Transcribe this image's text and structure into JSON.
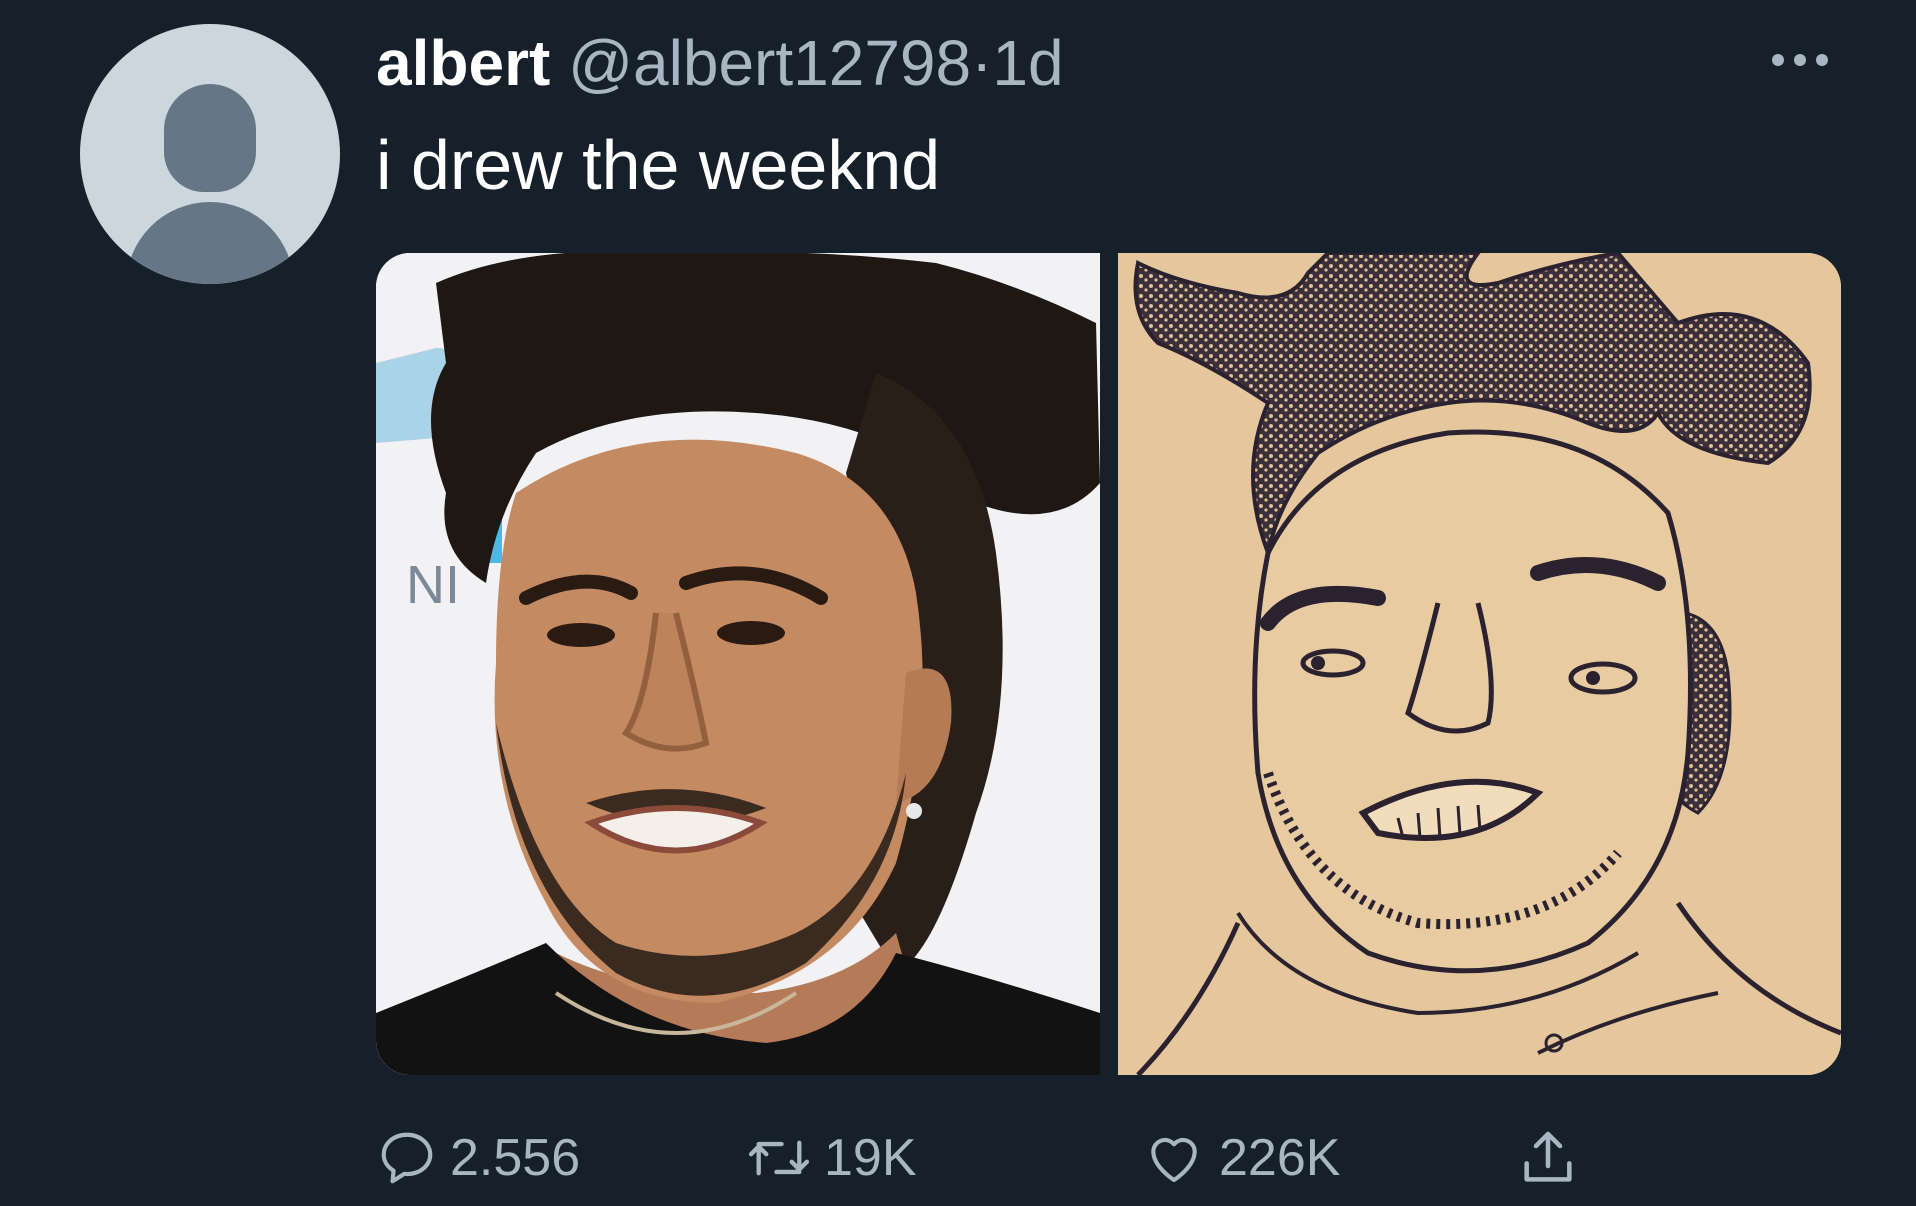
{
  "tweet": {
    "author_name": "albert",
    "handle": "@albert12798",
    "separator": "·",
    "time": "1d",
    "text": "i drew the weeknd",
    "media": [
      {
        "kind": "photo",
        "sign_text": "NI"
      },
      {
        "kind": "drawing"
      }
    ],
    "actions": {
      "replies": "2.556",
      "retweets": "19K",
      "likes": "226K"
    }
  },
  "colors": {
    "background": "#15202b",
    "primary_text": "#ffffff",
    "secondary_text": "#a9b6c2",
    "avatar_bg": "#ccd6dd",
    "avatar_fg": "#657786"
  },
  "icons": [
    "default-avatar-icon",
    "more-icon",
    "reply-icon",
    "retweet-icon",
    "like-icon",
    "share-icon"
  ]
}
